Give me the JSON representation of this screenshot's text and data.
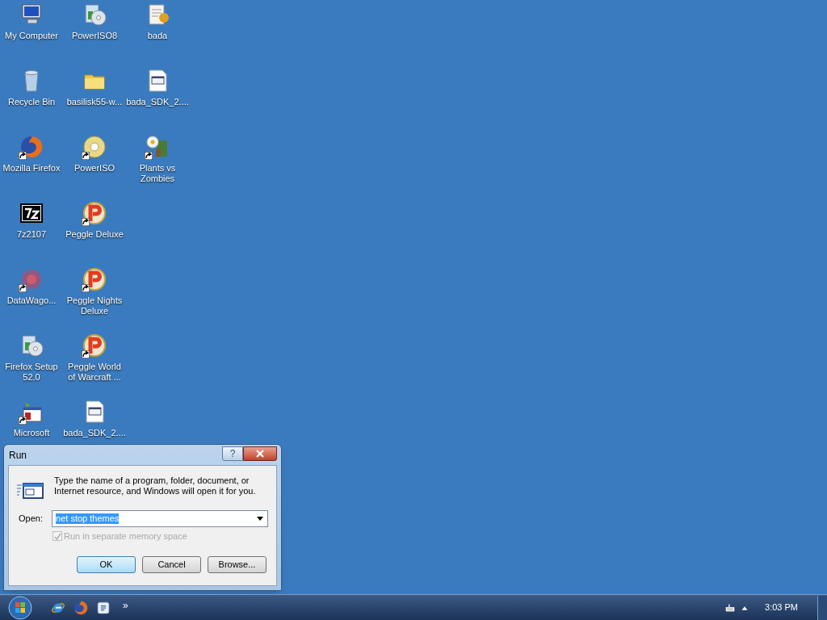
{
  "desktop": {
    "columns": [
      [
        {
          "label": "My Computer",
          "kind": "computer",
          "shortcut": false
        },
        {
          "label": "Recycle Bin",
          "kind": "recycle",
          "shortcut": false
        },
        {
          "label": "Mozilla Firefox",
          "kind": "firefox",
          "shortcut": true
        },
        {
          "label": "7z2107",
          "kind": "sevenzip",
          "shortcut": false
        },
        {
          "label": "DataWago...",
          "kind": "datawagon",
          "shortcut": true
        },
        {
          "label": "Firefox Setup 52.0",
          "kind": "installer",
          "shortcut": false
        },
        {
          "label": "Microsoft",
          "kind": "vb",
          "shortcut": true
        }
      ],
      [
        {
          "label": "PowerISO8",
          "kind": "installer",
          "shortcut": false
        },
        {
          "label": "basilisk55-w...",
          "kind": "folder",
          "shortcut": false
        },
        {
          "label": "PowerISO",
          "kind": "disc",
          "shortcut": true
        },
        {
          "label": "Peggle Deluxe",
          "kind": "peggle",
          "shortcut": true
        },
        {
          "label": "Peggle Nights Deluxe",
          "kind": "peggle",
          "shortcut": true
        },
        {
          "label": "Peggle World of Warcraft ...",
          "kind": "peggle",
          "shortcut": true
        },
        {
          "label": "bada_SDK_2....",
          "kind": "document",
          "shortcut": false
        }
      ],
      [
        {
          "label": "bada",
          "kind": "notepad",
          "shortcut": false
        },
        {
          "label": "bada_SDK_2....",
          "kind": "document",
          "shortcut": false
        },
        {
          "label": "Plants vs Zombies",
          "kind": "plant",
          "shortcut": true
        }
      ]
    ]
  },
  "run_dialog": {
    "title": "Run",
    "help_button": "?",
    "description": "Type the name of a program, folder, document, or Internet resource, and Windows will open it for you.",
    "open_label": "Open:",
    "value": "net stop themes",
    "checkbox": {
      "label": "Run in separate memory space",
      "checked": true,
      "disabled": true
    },
    "buttons": [
      {
        "label": "OK",
        "default": true
      },
      {
        "label": "Cancel",
        "default": false
      },
      {
        "label": "Browse...",
        "default": false
      }
    ]
  },
  "taskbar": {
    "quick_launch": [
      {
        "kind": "ie"
      },
      {
        "kind": "firefox"
      },
      {
        "kind": "app"
      }
    ],
    "chevron": "»",
    "tray": [
      {
        "kind": "keyboard"
      },
      {
        "kind": "show-hidden"
      }
    ],
    "clock": "3:03 PM"
  }
}
